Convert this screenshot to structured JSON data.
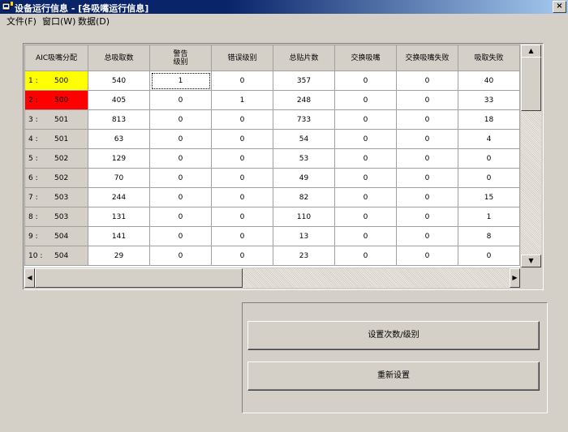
{
  "window": {
    "title": "设备运行信息 - [各吸嘴运行信息]",
    "close_glyph": "×"
  },
  "menu": [
    {
      "label": "文件(F)"
    },
    {
      "label": "窗口(W)"
    },
    {
      "label": "数据(D)"
    }
  ],
  "grid": {
    "columns": [
      "AIC吸嘴分配",
      "总吸取数",
      "警告\n级别",
      "错误级别",
      "总贴片数",
      "交换吸嘴",
      "交换吸嘴失败",
      "吸取失败"
    ],
    "rows": [
      {
        "idx": "1 :",
        "nozzle": "500",
        "highlight": "#ffff00",
        "values": [
          "540",
          "1",
          "0",
          "357",
          "0",
          "0",
          "40"
        ]
      },
      {
        "idx": "2 :",
        "nozzle": "500",
        "highlight": "#ff0000",
        "values": [
          "405",
          "0",
          "1",
          "248",
          "0",
          "0",
          "33"
        ]
      },
      {
        "idx": "3 :",
        "nozzle": "501",
        "highlight": "",
        "values": [
          "813",
          "0",
          "0",
          "733",
          "0",
          "0",
          "18"
        ]
      },
      {
        "idx": "4 :",
        "nozzle": "501",
        "highlight": "",
        "values": [
          "63",
          "0",
          "0",
          "54",
          "0",
          "0",
          "4"
        ]
      },
      {
        "idx": "5 :",
        "nozzle": "502",
        "highlight": "",
        "values": [
          "129",
          "0",
          "0",
          "53",
          "0",
          "0",
          "0"
        ]
      },
      {
        "idx": "6 :",
        "nozzle": "502",
        "highlight": "",
        "values": [
          "70",
          "0",
          "0",
          "49",
          "0",
          "0",
          "0"
        ]
      },
      {
        "idx": "7 :",
        "nozzle": "503",
        "highlight": "",
        "values": [
          "244",
          "0",
          "0",
          "82",
          "0",
          "0",
          "15"
        ]
      },
      {
        "idx": "8 :",
        "nozzle": "503",
        "highlight": "",
        "values": [
          "131",
          "0",
          "0",
          "110",
          "0",
          "0",
          "1"
        ]
      },
      {
        "idx": "9 :",
        "nozzle": "504",
        "highlight": "",
        "values": [
          "141",
          "0",
          "0",
          "13",
          "0",
          "0",
          "8"
        ]
      },
      {
        "idx": "10 :",
        "nozzle": "504",
        "highlight": "",
        "values": [
          "29",
          "0",
          "0",
          "23",
          "0",
          "0",
          "0"
        ]
      }
    ]
  },
  "buttons": {
    "set_count_level": "设置次数/级别",
    "reset": "重新设置"
  }
}
